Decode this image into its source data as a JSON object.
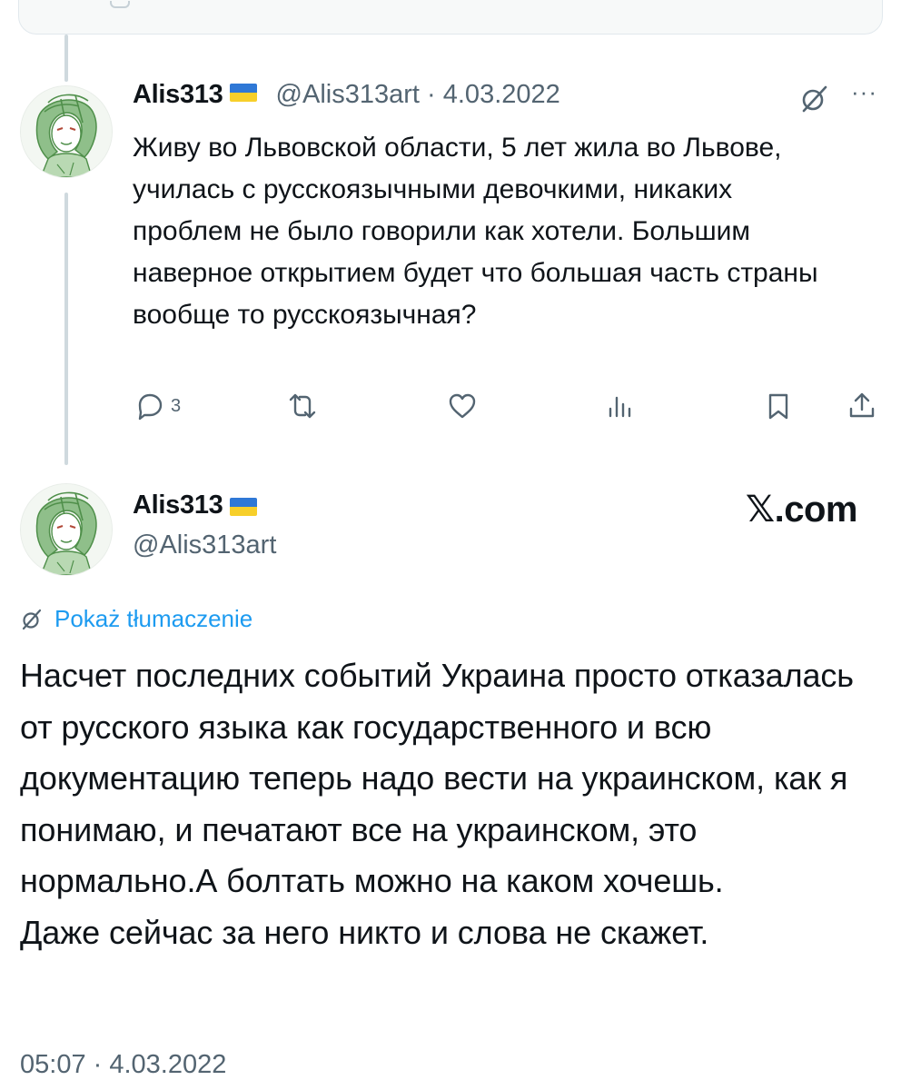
{
  "reply": {
    "display_name": "Alis313",
    "handle": "@Alis313art",
    "separator": "·",
    "date": "4.03.2022",
    "text": "Живу во Львовской области, 5 лет жила во Львове, училась с русскоязычными девочкими, никаких проблем не было говорили как хотели. Большим наверное открытием будет что большая часть страны вообще то русскоязычная?",
    "more_label": "···",
    "actions": {
      "reply_count": "3",
      "retweet_count": "",
      "like_count": "",
      "views_count": ""
    }
  },
  "main_tweet": {
    "display_name": "Alis313",
    "handle": "@Alis313art",
    "source_label": "𝕏.com",
    "translate_label": "Pokaż tłumaczenie",
    "text_lines": [
      "Насчет последних событий Украина просто отказалась от русского языка как государственного и всю документацию теперь надо вести на украинском, как я понимаю, и печатают все на украинском, это нормально.А болтать можно на каком хочешь.",
      "Даже сейчас за него никто и слова не скажет."
    ],
    "timestamp": "05:07 · 4.03.2022"
  },
  "colors": {
    "text": "#0f1419",
    "muted": "#536471",
    "link": "#1d9bf0",
    "thread_line": "#cfd9de",
    "flag_blue": "#2f78d6",
    "flag_yellow": "#f7cf2a"
  },
  "icons": [
    "grok-icon",
    "more-icon",
    "reply-icon",
    "retweet-icon",
    "like-icon",
    "views-icon",
    "bookmark-icon",
    "share-icon",
    "translate-icon"
  ]
}
